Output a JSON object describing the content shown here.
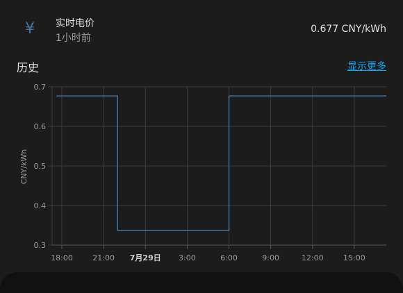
{
  "entity": {
    "icon": "yen-icon",
    "icon_glyph": "¥",
    "name": "实时电价",
    "last_changed": "1小时前",
    "state": "0.677 CNY/kWh"
  },
  "history": {
    "title": "历史",
    "show_more_label": "显示更多"
  },
  "colors": {
    "line": "#44739e",
    "icon": "#44739e",
    "link": "#03a9f4",
    "background": "#1c1c1c",
    "grid": "#3a3a3a"
  },
  "chart_data": {
    "type": "line",
    "step": true,
    "ylabel": "CNY/kWh",
    "ylim": [
      0.3,
      0.7
    ],
    "yticks": [
      "0.3",
      "0.4",
      "0.5",
      "0.6",
      "0.7"
    ],
    "xticks": [
      "18:00",
      "21:00",
      "7月29日",
      "3:00",
      "6:00",
      "9:00",
      "12:00",
      "15:00"
    ],
    "xticks_hours": [
      18,
      21,
      24,
      27,
      30,
      33,
      36,
      39
    ],
    "bold_tick": "7月29日",
    "grid": true,
    "series": [
      {
        "x_hours": [
          17.6,
          22.0,
          30.0,
          41.3
        ],
        "values": [
          0.677,
          0.337,
          0.677,
          0.677
        ]
      }
    ]
  }
}
